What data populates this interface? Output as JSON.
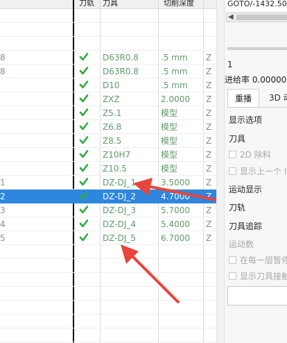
{
  "list": {
    "columns": {
      "checked": "刀轨",
      "tool": "刀具",
      "depth": "切削深度"
    },
    "rows": [
      {
        "num": "",
        "checked": false,
        "tool": "",
        "depth": "",
        "z": ""
      },
      {
        "num": "",
        "checked": false,
        "tool": "",
        "depth": "",
        "z": ""
      },
      {
        "num": "",
        "checked": false,
        "tool": "",
        "depth": "",
        "z": ""
      },
      {
        "num": "8",
        "checked": true,
        "tool": "D63R0.8",
        "depth": ".5 mm",
        "z": "Z"
      },
      {
        "num": "8",
        "checked": true,
        "tool": "D63R0.8",
        "depth": ".5 mm",
        "z": "Z"
      },
      {
        "num": "",
        "checked": true,
        "tool": "D10",
        "depth": ".5 mm",
        "z": "Z"
      },
      {
        "num": "",
        "checked": true,
        "tool": "ZXZ",
        "depth": "2.0000",
        "z": "Z"
      },
      {
        "num": "",
        "checked": true,
        "tool": "Z5.1",
        "depth": "模型",
        "z": "Z"
      },
      {
        "num": "",
        "checked": true,
        "tool": "Z6.8",
        "depth": "模型",
        "z": "Z"
      },
      {
        "num": "",
        "checked": true,
        "tool": "Z8.5",
        "depth": "模型",
        "z": "Z"
      },
      {
        "num": "",
        "checked": true,
        "tool": "Z10H7",
        "depth": "模型",
        "z": "Z"
      },
      {
        "num": "",
        "checked": true,
        "tool": "Z10.5",
        "depth": "模型",
        "z": "Z"
      },
      {
        "num": "1",
        "checked": true,
        "tool": "DZ-DJ_1",
        "depth": "3.5000",
        "z": "Z"
      },
      {
        "num": "2",
        "checked": true,
        "tool": "DZ-DJ_2",
        "depth": "4.7000",
        "z": "Z",
        "selected": true
      },
      {
        "num": "3",
        "checked": true,
        "tool": "DZ-DJ_3",
        "depth": "5.7000",
        "z": "Z"
      },
      {
        "num": "4",
        "checked": true,
        "tool": "DZ-DJ_4",
        "depth": "5.4000",
        "z": "Z"
      },
      {
        "num": "5",
        "checked": true,
        "tool": "DZ-DJ_5",
        "depth": "6.7000",
        "z": "Z"
      },
      {
        "num": "",
        "checked": false,
        "tool": "",
        "depth": "",
        "z": ""
      },
      {
        "num": "",
        "checked": false,
        "tool": "",
        "depth": "",
        "z": ""
      },
      {
        "num": "",
        "checked": false,
        "tool": "",
        "depth": "",
        "z": ""
      },
      {
        "num": "",
        "checked": false,
        "tool": "",
        "depth": "",
        "z": ""
      },
      {
        "num": "",
        "checked": false,
        "tool": "",
        "depth": "",
        "z": ""
      },
      {
        "num": "",
        "checked": false,
        "tool": "",
        "depth": "",
        "z": ""
      },
      {
        "num": "",
        "checked": false,
        "tool": "",
        "depth": "",
        "z": ""
      },
      {
        "num": "",
        "checked": false,
        "tool": "",
        "depth": "",
        "z": ""
      }
    ]
  },
  "panel": {
    "goto_text": "GOTO/-1432.50",
    "line_number": "1",
    "feed_text": "进给率 0.000000",
    "tabs": {
      "active": "重播",
      "inactive": "3D 动"
    },
    "display_options_heading": "显示选项",
    "tool_label": "刀具",
    "option_2d_removal": "2D 除料",
    "option_show_prev": "显示上一个 I",
    "motion_display_heading": "运动显示",
    "toolpath_label": "刀轨",
    "tool_trace_label": "刀具追踪",
    "motion_count_label": "运动数",
    "option_pause_each_layer": "在每一层暂停",
    "option_show_tool_contact": "显示刀具接触"
  },
  "colors": {
    "selected_row": "#2e86de",
    "check_green": "#2eaa3c",
    "text_green": "#5f9a6a",
    "annotation_red": "#e8453c"
  }
}
